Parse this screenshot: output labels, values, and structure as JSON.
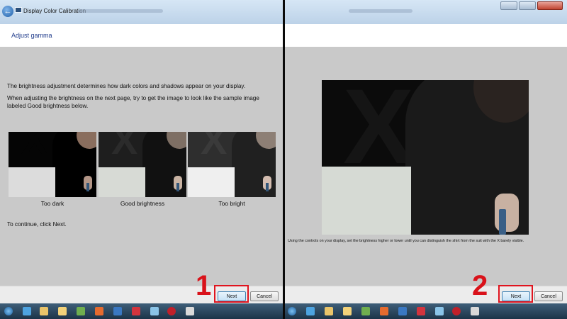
{
  "left": {
    "window_title": "Display Color Calibration",
    "page_heading": "Adjust gamma",
    "paragraphs": [
      "The brightness adjustment determines how dark colors and shadows appear on your display.",
      "When adjusting the brightness on the next page, try to get the image to look like the sample image labeled Good brightness below."
    ],
    "samples": [
      "Too dark",
      "Good brightness",
      "Too bright"
    ],
    "continue_text": "To continue, click Next.",
    "next_label": "Next",
    "cancel_label": "Cancel",
    "step_number": "1"
  },
  "right": {
    "caption": "Using the controls on your display, set the brightness higher or lower until you can distinguish the shirt from the suit with the X barely visible.",
    "next_label": "Next",
    "cancel_label": "Cancel",
    "step_number": "2"
  },
  "colors": {
    "highlight": "#e0141e",
    "step_number": "#d9121a",
    "page_background": "#c9c9c9",
    "header_text": "#1e3a8a"
  },
  "taskbar_icons": [
    "start-orb-icon",
    "ie-icon",
    "folder-icon",
    "media-player-icon",
    "app-icon",
    "app-icon",
    "app-icon",
    "app-icon",
    "app-icon",
    "app-icon"
  ]
}
